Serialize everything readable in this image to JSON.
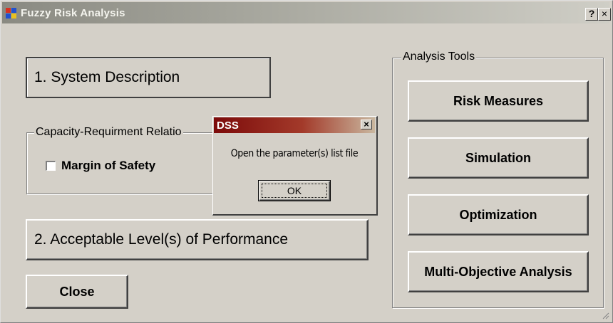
{
  "window": {
    "title": "Fuzzy Risk Analysis",
    "help_button": "?",
    "close_button": "×"
  },
  "main": {
    "system_description_label": "1. System Description",
    "acceptable_level_label": "2. Acceptable Level(s) of Performance",
    "close_label": "Close",
    "capacity_group": {
      "label": "Capacity-Requirment Relatio",
      "checkbox_label": "Margin of Safety",
      "checked": false
    },
    "analysis_tools": {
      "label": "Analysis Tools",
      "buttons": [
        "Risk Measures",
        "Simulation",
        "Optimization",
        "Multi-Objective Analysis"
      ]
    }
  },
  "dialog": {
    "title": "DSS",
    "close_button": "×",
    "message": "Open the parameter(s) list file",
    "ok_label": "OK"
  },
  "colors": {
    "face": "#d4d0c8",
    "dialog_title": "#7c0a0a",
    "title_bar": "#8a8a82"
  }
}
